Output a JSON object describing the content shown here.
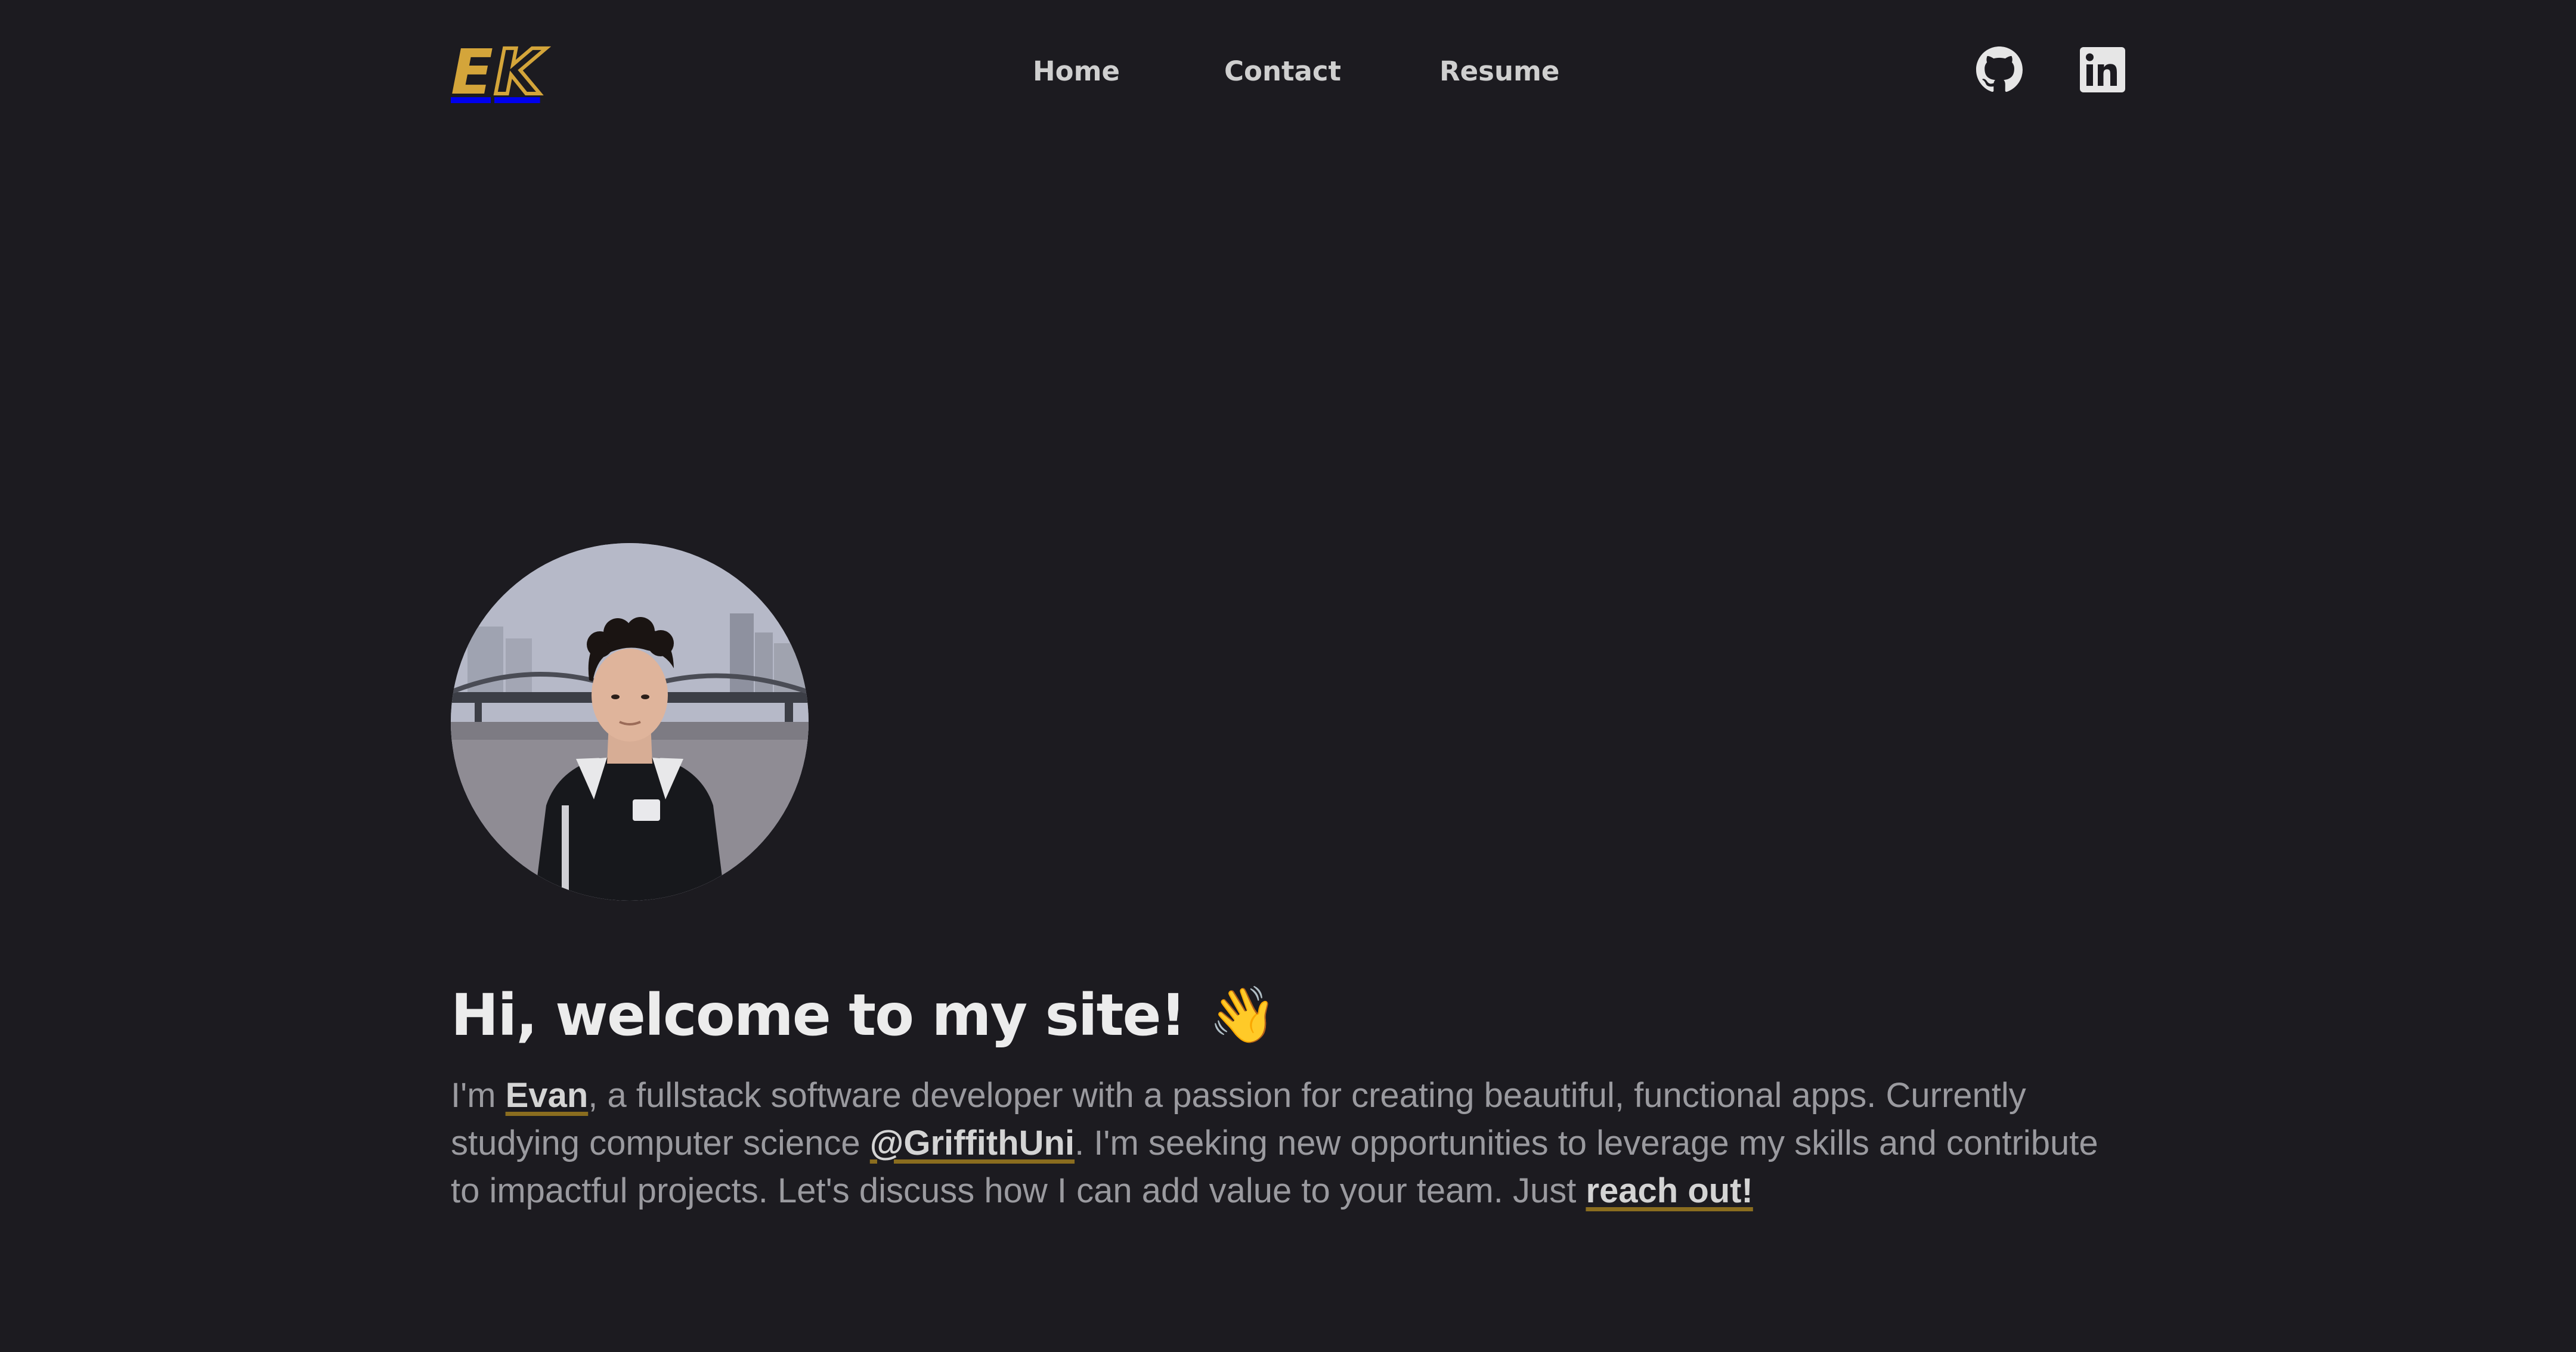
{
  "brand": {
    "logo_e": "E",
    "logo_k": "K",
    "accent": "#d4a53a"
  },
  "nav": {
    "links": [
      {
        "label": "Home"
      },
      {
        "label": "Contact"
      },
      {
        "label": "Resume"
      }
    ],
    "social": [
      {
        "icon": "github-icon"
      },
      {
        "icon": "linkedin-icon"
      }
    ]
  },
  "hero": {
    "avatar_icon": "profile-photo",
    "title": "Hi, welcome to my site!",
    "wave_emoji": "👋",
    "bio": {
      "p1": "I'm ",
      "name": "Evan",
      "p2": ", a fullstack software developer with a passion for creating beautiful, functional apps. Currently studying computer science ",
      "university": "@GriffithUni",
      "p3": ". I'm seeking new opportunities to leverage my skills and contribute to impactful projects. Let's discuss how I can add value to your team. Just ",
      "cta": "reach out!"
    }
  },
  "colors": {
    "background": "#1c1b20",
    "text": "#e6e6e6",
    "muted": "#9a9a9f",
    "underline": "#8a6d1f"
  }
}
